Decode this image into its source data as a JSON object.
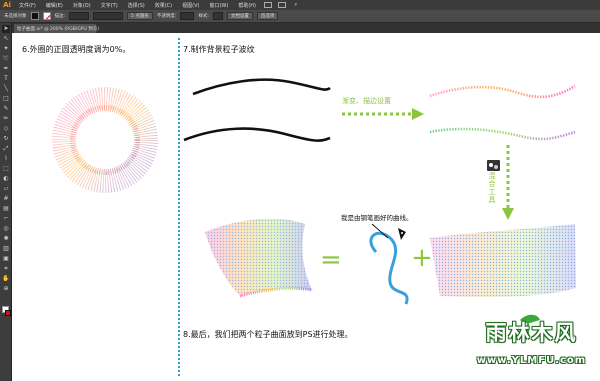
{
  "app": {
    "logo": "Ai"
  },
  "menu": [
    "文件(F)",
    "编辑(E)",
    "对象(O)",
    "文字(T)",
    "选择(S)",
    "效果(C)",
    "视图(V)",
    "窗口(W)",
    "帮助(H)"
  ],
  "control_bar": {
    "selection_label": "未选择对象",
    "stroke_label": "描边:",
    "brush_label": "5 点圆形",
    "opacity_label": "不透明度:",
    "style_label": "样式:",
    "doc_setup": "文档设置",
    "preferences": "首选项"
  },
  "document_tab": {
    "label": "粒子曲面.ai* @ 200% (RGB/GPU 预览)"
  },
  "steps": {
    "step6": "6.外圈的正圆透明度调为0%。",
    "step7": "7.制作背景粒子波纹",
    "step8": "8.最后，我们把两个粒子曲面放到PS进行处理。"
  },
  "annotations": {
    "gradient_settings": "渐变、描边设置",
    "blend_tool": "混合工具",
    "pen_curve": "我是由钢笔画好的曲线。"
  },
  "operators": {
    "equals": "=",
    "plus": "+"
  },
  "watermark": {
    "title": "雨林木风",
    "url": "www.YLMFU.com"
  },
  "colors": {
    "accent_green": "#8cc63f",
    "divider_blue": "#2aa0c8",
    "curve_blue": "#3aa0dc"
  },
  "icons": {
    "tools": [
      "selection-icon",
      "direct-selection-icon",
      "magic-wand-icon",
      "lasso-icon",
      "pen-icon",
      "type-icon",
      "line-icon",
      "rectangle-icon",
      "paintbrush-icon",
      "pencil-icon",
      "eraser-icon",
      "rotate-icon",
      "scale-icon",
      "width-icon",
      "free-transform-icon",
      "shape-builder-icon",
      "perspective-icon",
      "mesh-icon",
      "gradient-icon",
      "eyedropper-icon",
      "blend-icon",
      "symbol-sprayer-icon",
      "column-graph-icon",
      "artboard-icon",
      "slice-icon",
      "hand-icon",
      "zoom-icon"
    ]
  }
}
